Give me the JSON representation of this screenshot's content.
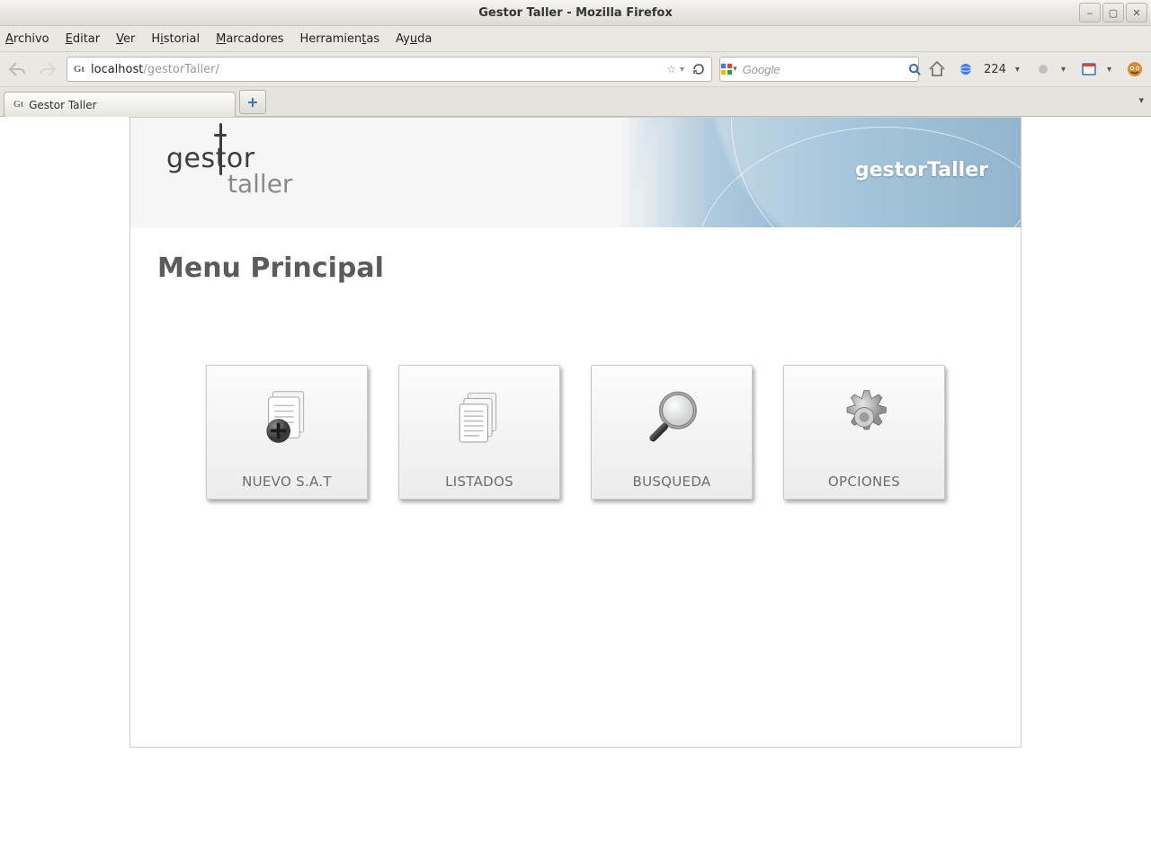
{
  "window": {
    "title": "Gestor Taller - Mozilla Firefox"
  },
  "menubar": {
    "archivo": "Archivo",
    "editar": "Editar",
    "ver": "Ver",
    "historial": "Historial",
    "marcadores": "Marcadores",
    "herramientas": "Herramientas",
    "ayuda": "Ayuda"
  },
  "nav": {
    "url_prefix": "localhost",
    "url_suffix": "/gestorTaller/",
    "search_placeholder": "Google",
    "favicon_label": "Gt"
  },
  "toolbar_right": {
    "counter": "224"
  },
  "tabs": {
    "active_label": "Gestor Taller",
    "active_favicon": "Gt"
  },
  "page": {
    "logo_line1": "ges or",
    "logo_line2": "taller",
    "brand_right": "gestorTaller",
    "heading": "Menu Principal",
    "cards": [
      {
        "label": "NUEVO S.A.T",
        "icon": "document-plus-icon"
      },
      {
        "label": "LISTADOS",
        "icon": "documents-icon"
      },
      {
        "label": "BUSQUEDA",
        "icon": "magnifier-icon"
      },
      {
        "label": "OPCIONES",
        "icon": "gear-icon"
      }
    ]
  }
}
